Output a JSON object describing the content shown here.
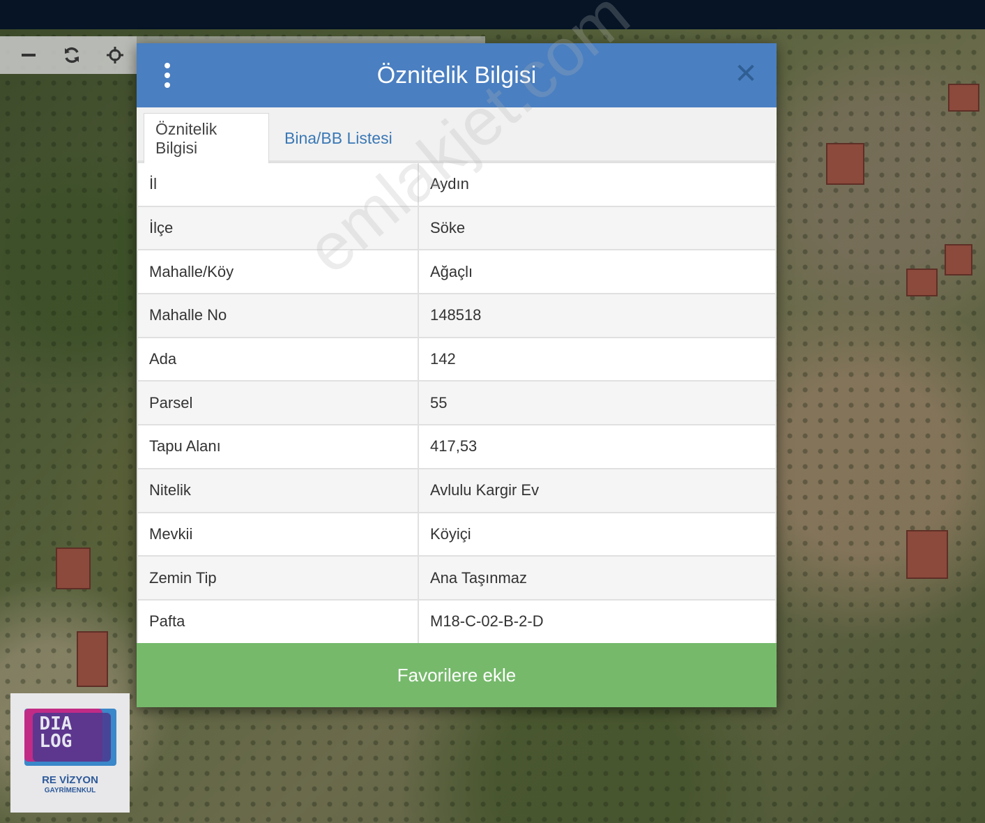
{
  "modal": {
    "title": "Öznitelik Bilgisi",
    "tabs": [
      {
        "label": "Öznitelik Bilgisi",
        "active": true
      },
      {
        "label": "Bina/BB Listesi",
        "active": false
      }
    ],
    "rows": [
      {
        "key": "İl",
        "value": "Aydın"
      },
      {
        "key": "İlçe",
        "value": "Söke"
      },
      {
        "key": "Mahalle/Köy",
        "value": "Ağaçlı"
      },
      {
        "key": "Mahalle No",
        "value": "148518"
      },
      {
        "key": "Ada",
        "value": "142"
      },
      {
        "key": "Parsel",
        "value": "55"
      },
      {
        "key": "Tapu Alanı",
        "value": "417,53"
      },
      {
        "key": "Nitelik",
        "value": "Avlulu Kargir Ev"
      },
      {
        "key": "Mevkii",
        "value": "Köyiçi"
      },
      {
        "key": "Zemin Tip",
        "value": "Ana Taşınmaz"
      },
      {
        "key": "Pafta",
        "value": "M18-C-02-B-2-D"
      }
    ],
    "favorite_button": "Favorilere ekle"
  },
  "map_toolbar": {
    "icons": [
      "zoom-out-icon",
      "refresh-icon",
      "locate-icon"
    ]
  },
  "watermark": "emlakjet.com",
  "logo": {
    "line1": "DIA",
    "line2": "LOG",
    "sub": "RE VİZYON",
    "sub2": "GAYRİMENKUL"
  },
  "colors": {
    "header": "#4a7fc1",
    "favorite": "#76b96b",
    "topbar": "#061426",
    "tab_link": "#3a78b5"
  }
}
